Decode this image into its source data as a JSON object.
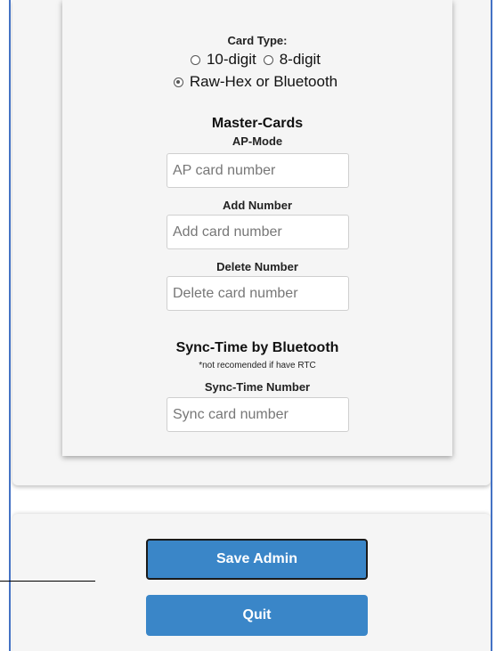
{
  "card_type": {
    "label": "Card Type:",
    "options": [
      {
        "label": "10-digit",
        "selected": false
      },
      {
        "label": "8-digit",
        "selected": false
      },
      {
        "label": "Raw-Hex or Bluetooth",
        "selected": true
      }
    ]
  },
  "master_cards": {
    "title": "Master-Cards",
    "ap_mode": {
      "label": "AP-Mode",
      "placeholder": "AP card number"
    },
    "add_number": {
      "label": "Add Number",
      "placeholder": "Add card number"
    },
    "delete_number": {
      "label": "Delete Number",
      "placeholder": "Delete card number"
    }
  },
  "sync_time": {
    "title": "Sync-Time by Bluetooth",
    "note": "*not recomended if have RTC",
    "number": {
      "label": "Sync-Time Number",
      "placeholder": "Sync card number"
    }
  },
  "buttons": {
    "save": "Save Admin",
    "quit": "Quit"
  },
  "colors": {
    "button_bg": "#3a86c8",
    "frame_border": "#4472c4"
  }
}
